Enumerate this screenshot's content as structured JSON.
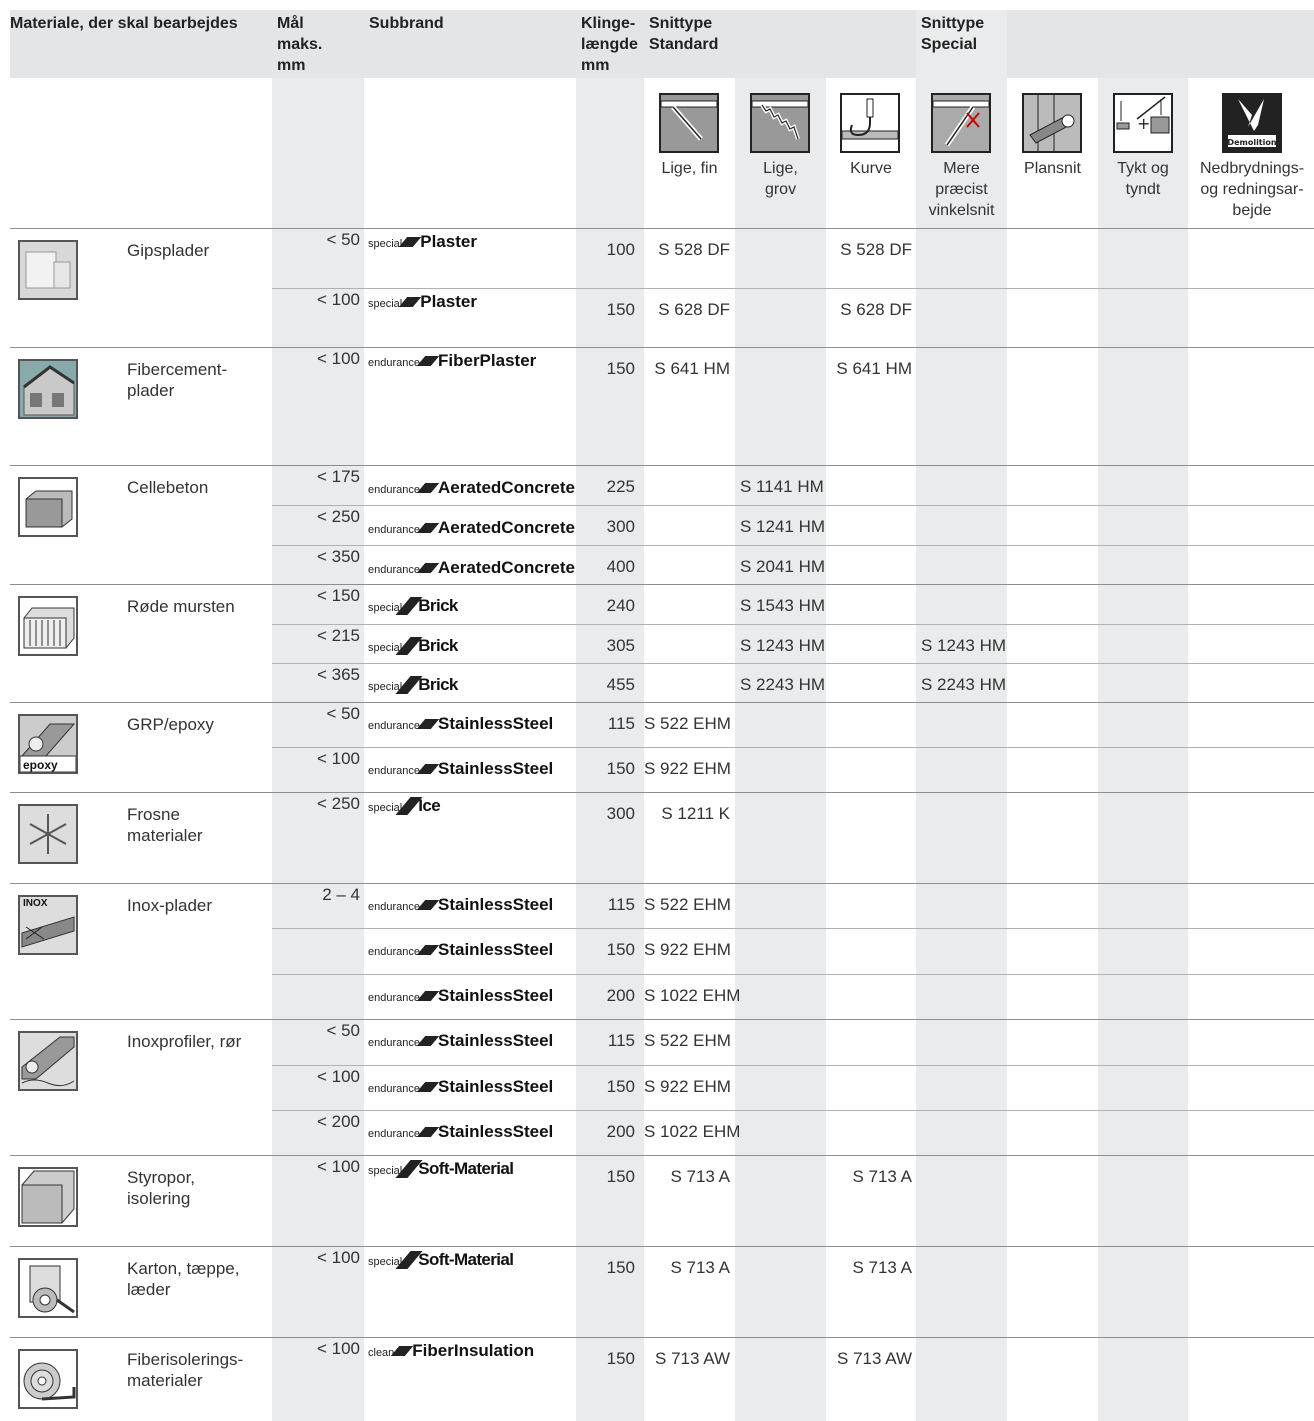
{
  "headers": {
    "material": "Materiale, der skal bearbejdes",
    "max_dim": [
      "Mål",
      "maks.",
      "mm"
    ],
    "subbrand": "Subbrand",
    "blade_length": [
      "Klinge-",
      "længde",
      "mm"
    ],
    "cut_standard": [
      "Snittype",
      "Standard"
    ],
    "cut_special": [
      "Snittype",
      "Special"
    ]
  },
  "cut_types": [
    {
      "label": "Lige, fin",
      "icon": "straight-fine-cut-icon"
    },
    {
      "label": "Lige,\ngrov",
      "icon": "straight-coarse-cut-icon"
    },
    {
      "label": "Kurve",
      "icon": "curve-cut-icon"
    },
    {
      "label": "Mere\npræcist\nvinkelsnit",
      "icon": "precise-angle-cut-icon"
    },
    {
      "label": "Plansnit",
      "icon": "flush-cut-icon"
    },
    {
      "label": "Tykt og\ntyndt",
      "icon": "thick-thin-cut-icon"
    },
    {
      "label": "Nedbrydnings-\nog redningsar-\nbejde",
      "icon": "demolition-icon",
      "icon_text": "Demolition"
    }
  ],
  "materials": [
    {
      "name": "Gipsplader",
      "icon": "plasterboard-icon",
      "rows": [
        {
          "max": "< 50",
          "prefix": "special",
          "brand": "Plaster",
          "length": "100",
          "fine": "S 528 DF",
          "coarse": "",
          "curve": "S 528 DF",
          "precise": ""
        },
        {
          "max": "< 100",
          "prefix": "special",
          "brand": "Plaster",
          "length": "150",
          "fine": "S 628 DF",
          "coarse": "",
          "curve": "S 628 DF",
          "precise": ""
        }
      ]
    },
    {
      "name": "Fibercement-\nplader",
      "icon": "fibre-cement-icon",
      "rows": [
        {
          "max": "< 100",
          "prefix": "endurance",
          "brand": "FiberPlaster",
          "length": "150",
          "fine": "S 641 HM",
          "coarse": "",
          "curve": "S 641 HM",
          "precise": ""
        }
      ]
    },
    {
      "name": "Cellebeton",
      "icon": "aerated-concrete-icon",
      "rows": [
        {
          "max": "< 175",
          "prefix": "endurance",
          "brand": "AeratedConcrete",
          "length": "225",
          "fine": "",
          "coarse": "S 1141 HM",
          "curve": "",
          "precise": ""
        },
        {
          "max": "< 250",
          "prefix": "endurance",
          "brand": "AeratedConcrete",
          "length": "300",
          "fine": "",
          "coarse": "S 1241 HM",
          "curve": "",
          "precise": ""
        },
        {
          "max": "< 350",
          "prefix": "endurance",
          "brand": "AeratedConcrete",
          "length": "400",
          "fine": "",
          "coarse": "S 2041 HM",
          "curve": "",
          "precise": ""
        }
      ]
    },
    {
      "name": "Røde mursten",
      "icon": "red-brick-icon",
      "rows": [
        {
          "max": "< 150",
          "prefix": "special",
          "brand": "Brick",
          "length": "240",
          "fine": "",
          "coarse": "S 1543 HM",
          "curve": "",
          "precise": ""
        },
        {
          "max": "< 215",
          "prefix": "special",
          "brand": "Brick",
          "length": "305",
          "fine": "",
          "coarse": "S 1243 HM",
          "curve": "",
          "precise": "S 1243 HM"
        },
        {
          "max": "< 365",
          "prefix": "special",
          "brand": "Brick",
          "length": "455",
          "fine": "",
          "coarse": "S 2243 HM",
          "curve": "",
          "precise": "S 2243 HM"
        }
      ]
    },
    {
      "name": "GRP/epoxy",
      "icon": "grp-epoxy-icon",
      "icon_text": "epoxy",
      "rows": [
        {
          "max": "< 50",
          "prefix": "endurance",
          "brand": "StainlessSteel",
          "length": "115",
          "fine": "S 522 EHM",
          "coarse": "",
          "curve": "",
          "precise": ""
        },
        {
          "max": "< 100",
          "prefix": "endurance",
          "brand": "StainlessSteel",
          "length": "150",
          "fine": "S 922 EHM",
          "coarse": "",
          "curve": "",
          "precise": ""
        }
      ]
    },
    {
      "name": "Frosne\nmaterialer",
      "icon": "frozen-material-icon",
      "rows": [
        {
          "max": "< 250",
          "prefix": "special",
          "brand": "Ice",
          "length": "300",
          "fine": "S 1211 K",
          "coarse": "",
          "curve": "",
          "precise": ""
        }
      ]
    },
    {
      "name": "Inox-plader",
      "icon": "inox-sheet-icon",
      "icon_text": "INOX",
      "rows": [
        {
          "max": "2 – 4",
          "prefix": "endurance",
          "brand": "StainlessSteel",
          "length": "115",
          "fine": "S 522 EHM",
          "coarse": "",
          "curve": "",
          "precise": ""
        },
        {
          "max": "",
          "prefix": "endurance",
          "brand": "StainlessSteel",
          "length": "150",
          "fine": "S 922 EHM",
          "coarse": "",
          "curve": "",
          "precise": ""
        },
        {
          "max": "",
          "prefix": "endurance",
          "brand": "StainlessSteel",
          "length": "200",
          "fine": "S 1022 EHM",
          "coarse": "",
          "curve": "",
          "precise": ""
        }
      ]
    },
    {
      "name": "Inoxprofiler, rør",
      "icon": "inox-profile-icon",
      "rows": [
        {
          "max": "< 50",
          "prefix": "endurance",
          "brand": "StainlessSteel",
          "length": "115",
          "fine": "S 522 EHM",
          "coarse": "",
          "curve": "",
          "precise": ""
        },
        {
          "max": "< 100",
          "prefix": "endurance",
          "brand": "StainlessSteel",
          "length": "150",
          "fine": "S 922 EHM",
          "coarse": "",
          "curve": "",
          "precise": ""
        },
        {
          "max": "< 200",
          "prefix": "endurance",
          "brand": "StainlessSteel",
          "length": "200",
          "fine": "S 1022 EHM",
          "coarse": "",
          "curve": "",
          "precise": ""
        }
      ]
    },
    {
      "name": "Styropor,\nisolering",
      "icon": "styrofoam-icon",
      "rows": [
        {
          "max": "< 100",
          "prefix": "special",
          "brand": "Soft-Material",
          "length": "150",
          "fine": "S 713 A",
          "coarse": "",
          "curve": "S 713 A",
          "precise": ""
        }
      ]
    },
    {
      "name": "Karton, tæppe,\nlæder",
      "icon": "carton-roll-icon",
      "rows": [
        {
          "max": "< 100",
          "prefix": "special",
          "brand": "Soft-Material",
          "length": "150",
          "fine": "S 713 A",
          "coarse": "",
          "curve": "S 713 A",
          "precise": ""
        }
      ]
    },
    {
      "name": "Fiberisolerings-\nmaterialer",
      "icon": "fibre-insulation-icon",
      "rows": [
        {
          "max": "< 100",
          "prefix": "clean",
          "brand": "FiberInsulation",
          "length": "150",
          "fine": "S 713 AW",
          "coarse": "",
          "curve": "S 713 AW",
          "precise": ""
        }
      ]
    }
  ]
}
